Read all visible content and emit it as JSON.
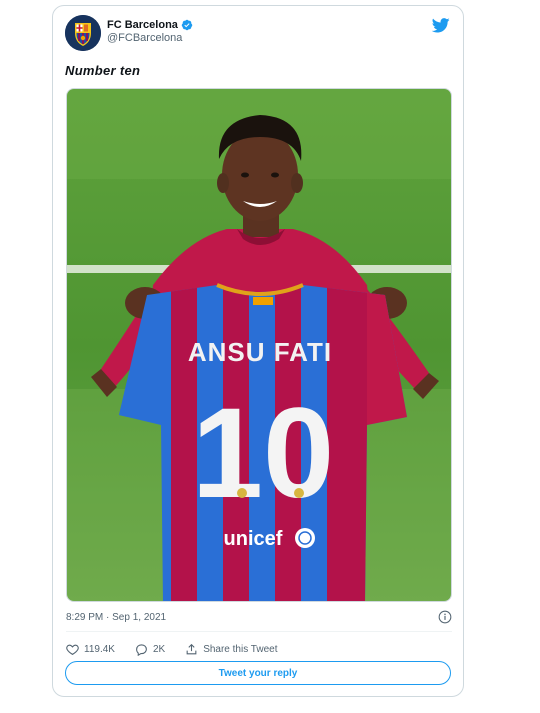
{
  "author": {
    "name": "FC Barcelona",
    "handle": "@FCBarcelona",
    "verified": true
  },
  "tweet": {
    "text": "Number ten"
  },
  "photo": {
    "jersey_name": "ANSU FATI",
    "jersey_number": "10",
    "sponsor": "unicef"
  },
  "meta": {
    "timestamp": "8:29 PM · Sep 1, 2021"
  },
  "actions": {
    "likes": "119.4K",
    "replies": "2K",
    "share_label": "Share this Tweet"
  },
  "reply_button_label": "Tweet your reply",
  "colors": {
    "twitter_blue": "#1d9bf0",
    "barca_blue": "#2a6fd6",
    "barca_red": "#b3124a"
  }
}
